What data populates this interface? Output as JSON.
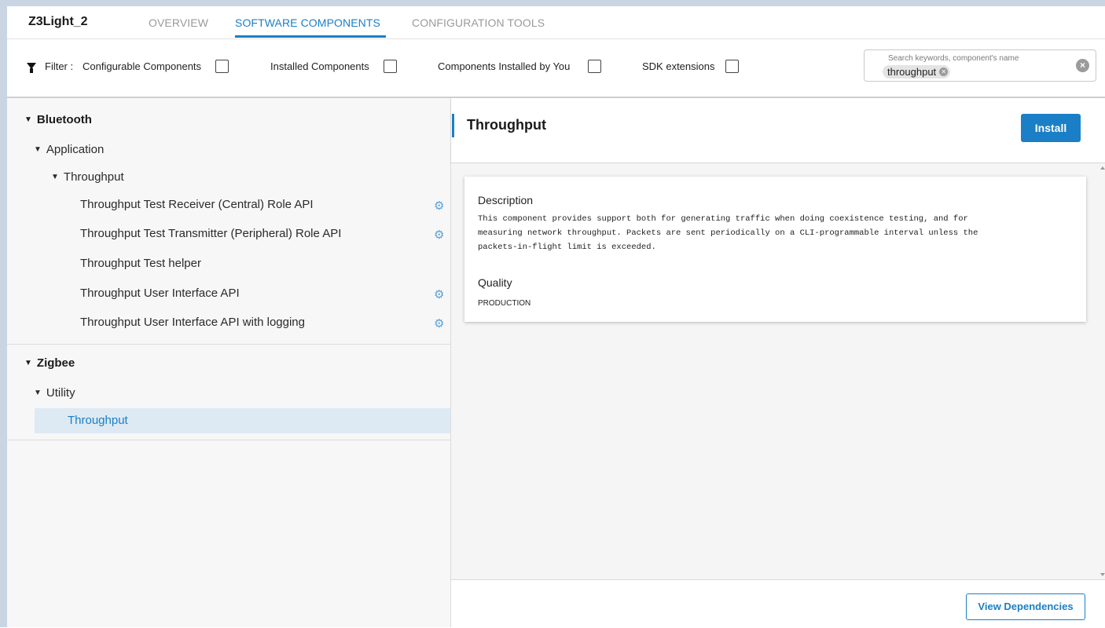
{
  "project": {
    "title": "Z3Light_2"
  },
  "tabs": [
    {
      "label": "OVERVIEW",
      "active": false
    },
    {
      "label": "SOFTWARE COMPONENTS",
      "active": true
    },
    {
      "label": "CONFIGURATION TOOLS",
      "active": false
    }
  ],
  "filters": {
    "filter_label": "Filter :",
    "items": [
      {
        "label": "Configurable Components",
        "checked": false
      },
      {
        "label": "Installed Components",
        "checked": false
      },
      {
        "label": "Components Installed by You",
        "checked": false
      },
      {
        "label": "SDK extensions",
        "checked": false
      }
    ]
  },
  "search": {
    "placeholder": "Search keywords, component's name",
    "chip": "throughput"
  },
  "tree": {
    "bluetooth": {
      "label": "Bluetooth",
      "application": {
        "label": "Application",
        "throughput": {
          "label": "Throughput",
          "items": [
            {
              "label": "Throughput Test Receiver (Central) Role API",
              "configurable": true
            },
            {
              "label": "Throughput Test Transmitter (Peripheral) Role API",
              "configurable": true
            },
            {
              "label": "Throughput Test helper",
              "configurable": false
            },
            {
              "label": "Throughput User Interface API",
              "configurable": true
            },
            {
              "label": "Throughput User Interface API with logging",
              "configurable": true
            }
          ]
        }
      }
    },
    "zigbee": {
      "label": "Zigbee",
      "utility": {
        "label": "Utility",
        "items": [
          {
            "label": "Throughput",
            "selected": true
          }
        ]
      }
    }
  },
  "detail": {
    "title": "Throughput",
    "install_label": "Install",
    "description_heading": "Description",
    "description_lines": [
      "This component provides support both for generating traffic when doing coexistence testing, and for",
      "measuring network throughput. Packets are sent periodically on a CLI-programmable interval unless the",
      "packets-in-flight limit is exceeded."
    ],
    "quality_heading": "Quality",
    "quality_value": "PRODUCTION",
    "view_dependencies_label": "View Dependencies"
  },
  "colors": {
    "accent": "#1a7fc6",
    "selected_row": "#ddeaf4",
    "gear_icon": "#5aa0d8"
  }
}
